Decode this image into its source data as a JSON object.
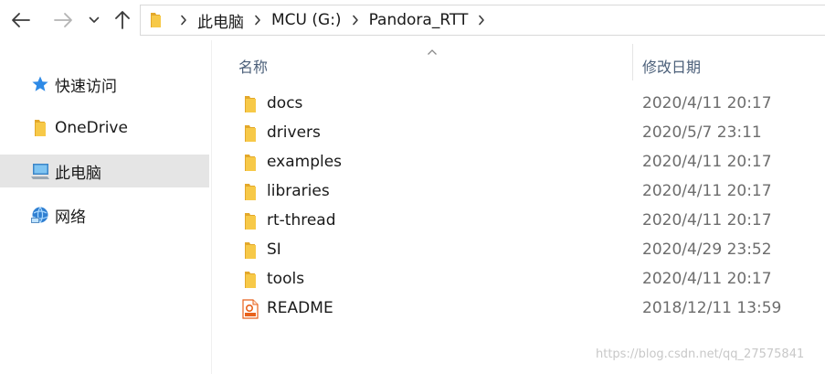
{
  "window": {
    "breadcrumbs": [
      "此电脑",
      "MCU (G:)",
      "Pandora_RTT"
    ],
    "icons": {
      "back": "arrow-left-icon",
      "forward": "arrow-right-icon",
      "recent": "chevron-down-icon",
      "up": "arrow-up-icon"
    }
  },
  "nav": {
    "items": [
      {
        "label": "快速访问",
        "icon": "star-icon",
        "selected": false
      },
      {
        "label": "OneDrive",
        "icon": "folder-icon",
        "selected": false
      },
      {
        "label": "此电脑",
        "icon": "computer-icon",
        "selected": true
      },
      {
        "label": "网络",
        "icon": "network-icon",
        "selected": false
      }
    ]
  },
  "list": {
    "columns": {
      "name": "名称",
      "date": "修改日期"
    },
    "sort": "name-ascending",
    "rows": [
      {
        "name": "docs",
        "date": "2020/4/11 20:17",
        "type": "folder"
      },
      {
        "name": "drivers",
        "date": "2020/5/7 23:11",
        "type": "folder"
      },
      {
        "name": "examples",
        "date": "2020/4/11 20:17",
        "type": "folder"
      },
      {
        "name": "libraries",
        "date": "2020/4/11 20:17",
        "type": "folder"
      },
      {
        "name": "rt-thread",
        "date": "2020/4/11 20:17",
        "type": "folder"
      },
      {
        "name": "SI",
        "date": "2020/4/29 23:52",
        "type": "folder"
      },
      {
        "name": "tools",
        "date": "2020/4/11 20:17",
        "type": "folder"
      },
      {
        "name": "README",
        "date": "2018/12/11 13:59",
        "type": "pdf"
      }
    ]
  },
  "watermark": "https://blog.csdn.net/qq_27575841",
  "colors": {
    "folder": "#f7c948",
    "folder_dark": "#e3a82b",
    "selected_bg": "#e5e5e5",
    "header_text": "#4c607a",
    "date_text": "#6d6d6d",
    "pdf_accent": "#e8621c"
  }
}
